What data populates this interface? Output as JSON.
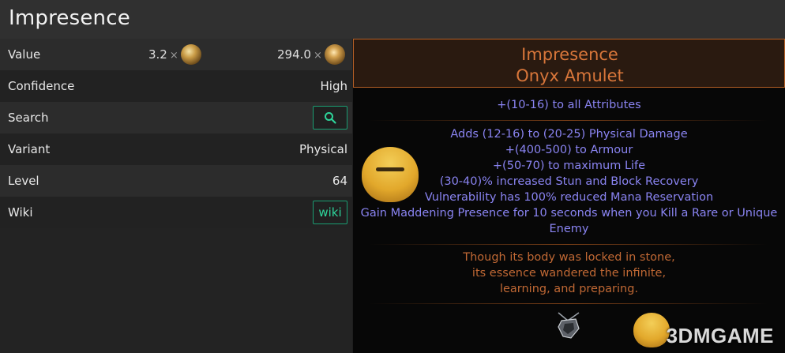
{
  "window": {
    "title": "Impresence"
  },
  "rows": {
    "value": {
      "label": "Value",
      "amount1": "3.2",
      "amount2": "294.0",
      "times": "×",
      "currency1": "exalted-orb-icon",
      "currency2": "divine-orb-icon"
    },
    "confidence": {
      "label": "Confidence",
      "value": "High"
    },
    "search": {
      "label": "Search",
      "icon": "search-icon"
    },
    "variant": {
      "label": "Variant",
      "value": "Physical"
    },
    "level": {
      "label": "Level",
      "value": "64"
    },
    "wiki": {
      "label": "Wiki",
      "button": "wiki"
    }
  },
  "tooltip": {
    "name": "Impresence",
    "base": "Onyx Amulet",
    "implicit": "+(10-16) to all Attributes",
    "explicit": [
      "Adds (12-16) to (20-25) Physical Damage",
      "+(400-500) to Armour",
      "+(50-70) to maximum Life",
      "(30-40)% increased Stun and Block Recovery",
      "Vulnerability has 100% reduced Mana Reservation",
      "Gain Maddening Presence for 10 seconds when you Kill a Rare or Unique",
      "Enemy"
    ],
    "flavour": [
      "Though its body was locked in stone,",
      "its essence wandered the infinite,",
      "learning, and preparing."
    ]
  },
  "watermark": "3DMGAME",
  "colors": {
    "unique_name": "#d8763a",
    "mod_text": "#8a84f2",
    "flavour_text": "#c06834",
    "button_accent": "#2ed49a"
  }
}
